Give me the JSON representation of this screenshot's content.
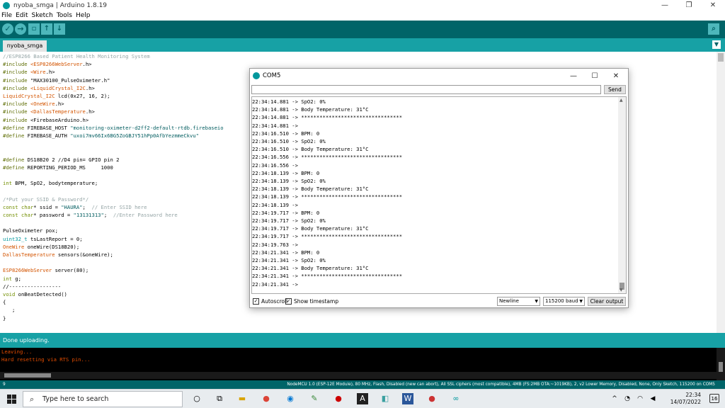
{
  "window": {
    "title": "nyoba_smga | Arduino 1.8.19",
    "minimize": "—",
    "maximize": "❐",
    "close": "✕"
  },
  "menu": [
    "File",
    "Edit",
    "Sketch",
    "Tools",
    "Help"
  ],
  "toolbar": {
    "verify_icon": "✓",
    "upload_icon": "→",
    "new_icon": "▫",
    "open_icon": "↑",
    "save_icon": "↓",
    "serial_icon": "⌕"
  },
  "tab": {
    "name": "nyoba_smga",
    "menu_icon": "▼"
  },
  "code": [
    [
      [
        "c",
        "//ESP8266 Based Patient Health Monitoring System"
      ]
    ],
    [
      [
        "d",
        "#include "
      ],
      [
        "i",
        "<ESP8266WebServer"
      ],
      [
        "n",
        ".h>"
      ]
    ],
    [
      [
        "d",
        "#include "
      ],
      [
        "i",
        "<Wire"
      ],
      [
        "n",
        ".h>"
      ]
    ],
    [
      [
        "d",
        "#include "
      ],
      [
        "n",
        "\"MAX30100_PulseOximeter.h\""
      ]
    ],
    [
      [
        "d",
        "#include "
      ],
      [
        "i",
        "<LiquidCrystal_I2C"
      ],
      [
        "n",
        ".h>"
      ]
    ],
    [
      [
        "i",
        "LiquidCrystal_I2C"
      ],
      [
        "n",
        " lcd(0x27, 16, 2);"
      ]
    ],
    [
      [
        "d",
        "#include "
      ],
      [
        "i",
        "<OneWire"
      ],
      [
        "n",
        ".h>"
      ]
    ],
    [
      [
        "d",
        "#include "
      ],
      [
        "i",
        "<DallasTemperature"
      ],
      [
        "n",
        ".h>"
      ]
    ],
    [
      [
        "d",
        "#include "
      ],
      [
        "n",
        "<FirebaseArduino.h>"
      ]
    ],
    [
      [
        "d",
        "#define "
      ],
      [
        "n",
        "FIREBASE_HOST "
      ],
      [
        "s",
        "\"monitoring-oximeter-d2ff2-default-rtdb.firebaseio"
      ]
    ],
    [
      [
        "d",
        "#define "
      ],
      [
        "n",
        "FIREBASE_AUTH "
      ],
      [
        "s",
        "\"uxoi7mv66Ix6BG5ZoGBJY51hPp0AfbYezmmeCkvu\""
      ]
    ],
    [
      [
        "n",
        ""
      ]
    ],
    [
      [
        "n",
        ""
      ]
    ],
    [
      [
        "d",
        "#define "
      ],
      [
        "n",
        "DS18B20 2 //D4 pin= GPIO pin 2"
      ]
    ],
    [
      [
        "d",
        "#define "
      ],
      [
        "n",
        "REPORTING_PERIOD_MS     1000"
      ]
    ],
    [
      [
        "n",
        ""
      ]
    ],
    [
      [
        "k",
        "int"
      ],
      [
        "n",
        " BPM, SpO2, bodytemperature;"
      ]
    ],
    [
      [
        "n",
        ""
      ]
    ],
    [
      [
        "c",
        "/*Put your SSID & Password*/"
      ]
    ],
    [
      [
        "k",
        "const"
      ],
      [
        "n",
        " "
      ],
      [
        "k",
        "char"
      ],
      [
        "n",
        "* ssid = "
      ],
      [
        "s",
        "\"HAURA\""
      ],
      [
        "n",
        ";  "
      ],
      [
        "c",
        "// Enter SSID here"
      ]
    ],
    [
      [
        "k",
        "const"
      ],
      [
        "n",
        " "
      ],
      [
        "k",
        "char"
      ],
      [
        "n",
        "* password = "
      ],
      [
        "s",
        "\"13131313\""
      ],
      [
        "n",
        ";  "
      ],
      [
        "c",
        "//Enter Password here"
      ]
    ],
    [
      [
        "n",
        ""
      ]
    ],
    [
      [
        "n",
        "PulseOximeter pox;"
      ]
    ],
    [
      [
        "t",
        "uint32_t"
      ],
      [
        "n",
        " tsLastReport = 0;"
      ]
    ],
    [
      [
        "i",
        "OneWire"
      ],
      [
        "n",
        " oneWire(DS18B20);"
      ]
    ],
    [
      [
        "i",
        "DallasTemperature"
      ],
      [
        "n",
        " sensors(&oneWire);"
      ]
    ],
    [
      [
        "n",
        ""
      ]
    ],
    [
      [
        "i",
        "ESP8266WebServer"
      ],
      [
        "n",
        " server(80);"
      ]
    ],
    [
      [
        "k",
        "int"
      ],
      [
        "n",
        " g;"
      ]
    ],
    [
      [
        "n",
        "//-----------------"
      ]
    ],
    [
      [
        "k",
        "void"
      ],
      [
        "n",
        " onBeatDetected()"
      ]
    ],
    [
      [
        "n",
        "{"
      ]
    ],
    [
      [
        "n",
        "   ;"
      ]
    ],
    [
      [
        "n",
        "}"
      ]
    ]
  ],
  "status_text": "Done uploading.",
  "console_lines": [
    "Leaving...",
    "Hard resetting via RTS pin..."
  ],
  "infobar": {
    "line_number": "9",
    "board": "NodeMCU 1.0 (ESP-12E Module), 80 MHz, Flash, Disabled (new can abort), All SSL ciphers (most compatible), 4MB (FS:2MB OTA:~1019KB), 2, v2 Lower Memory, Disabled, None, Only Sketch, 115200 on COM5"
  },
  "serial_monitor": {
    "title": "COM5",
    "send_label": "Send",
    "input_value": "",
    "lines": [
      "22:34:14.881 -> SpO2: 0%",
      "22:34:14.881 -> Body Temperature: 31°C",
      "22:34:14.881 -> *********************************",
      "22:34:14.881 ->",
      "22:34:16.510 -> BPM: 0",
      "22:34:16.510 -> SpO2: 0%",
      "22:34:16.510 -> Body Temperature: 31°C",
      "22:34:16.556 -> *********************************",
      "22:34:16.556 ->",
      "22:34:18.139 -> BPM: 0",
      "22:34:18.139 -> SpO2: 0%",
      "22:34:18.139 -> Body Temperature: 31°C",
      "22:34:18.139 -> *********************************",
      "22:34:18.139 ->",
      "22:34:19.717 -> BPM: 0",
      "22:34:19.717 -> SpO2: 0%",
      "22:34:19.717 -> Body Temperature: 31°C",
      "22:34:19.717 -> *********************************",
      "22:34:19.763 ->",
      "22:34:21.341 -> BPM: 0",
      "22:34:21.341 -> SpO2: 0%",
      "22:34:21.341 -> Body Temperature: 31°C",
      "22:34:21.341 -> *********************************",
      "22:34:21.341 ->"
    ],
    "autoscroll_label": "Autoscroll",
    "autoscroll_checked": true,
    "timestamp_label": "Show timestamp",
    "timestamp_checked": true,
    "line_ending": "Newline",
    "baud": "115200 baud",
    "clear_label": "Clear output"
  },
  "taskbar": {
    "search_placeholder": "Type here to search",
    "clock_time": "22:34",
    "clock_date": "14/07/2022",
    "notification_count": "16"
  },
  "colors": {
    "toolbar": "#006468",
    "tabbar": "#17a1a5",
    "status": "#17a1a5",
    "console_text": "#e34c00"
  }
}
